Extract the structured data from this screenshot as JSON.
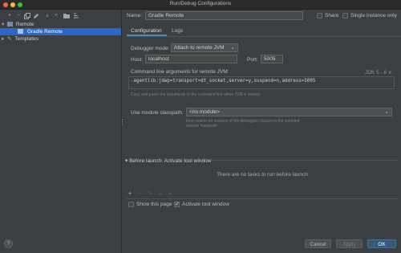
{
  "window": {
    "title": "Run/Debug Configurations"
  },
  "toolbar": {
    "icons": [
      "add-icon",
      "remove-icon",
      "copy-icon",
      "edit-icon",
      "move-up-icon",
      "move-down-icon",
      "folder-icon",
      "sort-icon"
    ]
  },
  "tree": {
    "remote_label": "Remote",
    "gradle_remote_label": "Gradle Remote",
    "templates_label": "Templates"
  },
  "form": {
    "name_label": "Name:",
    "name_value": "Gradle Remote",
    "share_label": "Share",
    "single_instance_label": "Single instance only",
    "tabs": [
      "Configuration",
      "Logs"
    ],
    "debugger_mode_label": "Debugger mode:",
    "debugger_mode_value": "Attach to remote JVM",
    "host_label": "Host:",
    "host_value": "localhost",
    "port_label": "Port:",
    "port_value": "5005",
    "cmdline_label": "Command line arguments for remote JVM:",
    "jdk_label": "JDK 5 - 8 ∨",
    "cmdline_value": "-agentlib:jdwp=transport=dt_socket,server=y,suspend=n,address=5005",
    "cmdline_hint": "Copy and paste the arguments to the command line when JVM is started",
    "classpath_label": "Use module classpath:",
    "classpath_value": "<no module>",
    "classpath_hint_line1": "First search for sources of the debugged classes in the selected",
    "classpath_hint_line2": "module classpath"
  },
  "before_launch": {
    "title": "Before launch: Activate tool window",
    "empty_text": "There are no tasks to run before launch",
    "show_page_label": "Show this page",
    "activate_label": "Activate tool window"
  },
  "buttons": {
    "help": "?",
    "cancel": "Cancel",
    "apply": "Apply",
    "ok": "OK"
  },
  "colors": {
    "accent": "#2f65ca",
    "ok_button": "#365880",
    "background": "#3c3f41"
  }
}
